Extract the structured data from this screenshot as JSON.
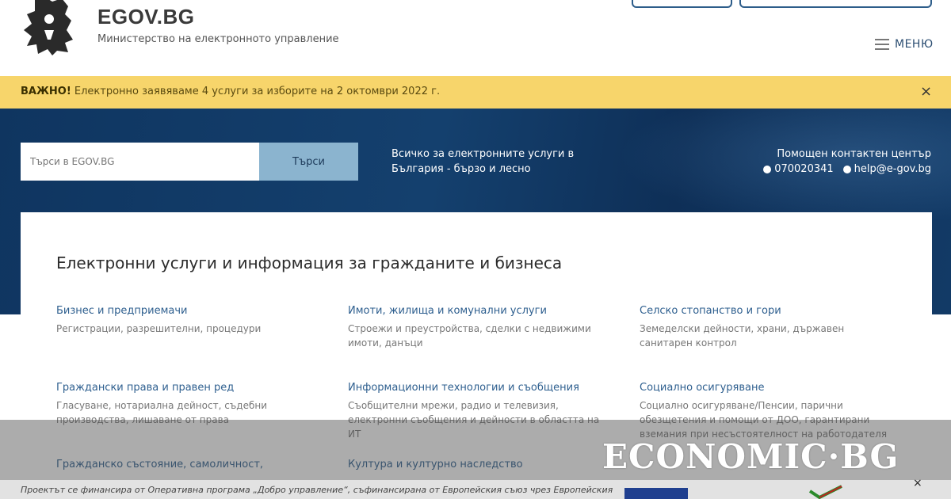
{
  "header": {
    "site_title": "EGOV.BG",
    "site_subtitle": "Министерство на електронното управление",
    "menu_label": "МЕНЮ"
  },
  "notice": {
    "strong": "ВАЖНО!",
    "text": " Електронно заявяваме 4 услуги за изборите на 2 октомври 2022 г.",
    "close": "×"
  },
  "hero": {
    "search_placeholder": "Търси в EGOV.BG",
    "search_button": "Търси",
    "tagline_line1": "Всичко за електронните услуги в",
    "tagline_line2": "България - бързо и лесно",
    "contact_title": "Помощен контактен център",
    "phone": "070020341",
    "email": "help@e-gov.bg"
  },
  "services": {
    "title": "Електронни услуги и информация за гражданите и бизнеса",
    "items": [
      {
        "title": "Бизнес и предприемачи",
        "desc": "Регистрации, разрешителни, процедури"
      },
      {
        "title": "Имоти, жилища и комунални услуги",
        "desc": "Строежи и преустройства, сделки с недвижими имоти, данъци"
      },
      {
        "title": "Селско стопанство и гори",
        "desc": "Земеделски дейности, храни, държавен санитарен контрол"
      },
      {
        "title": "Граждански права и правен ред",
        "desc": "Гласуване, нотариална дейност, съдебни производства, лишаване от права"
      },
      {
        "title": "Информационни технологии и съобщения",
        "desc": "Съобщителни мрежи, радио и телевизия, електронни съобщения и дейности в областта на ИТ"
      },
      {
        "title": "Социално осигуряване",
        "desc": "Социално осигуряване/Пенсии, парични обезщетения и помощи от ДОО, гарантирани вземания при несъстоятелност на работодателя"
      },
      {
        "title": "Гражданско състояние, самоличност,",
        "desc": ""
      },
      {
        "title": "Култура и културно наследство",
        "desc": ""
      }
    ]
  },
  "footer": {
    "text": "Проектът се финансира от Оперативна програма „Добро управление“, съфинансирана от Европейския съюз чрез Европейския",
    "close": "×"
  },
  "watermark": "ECONOMIC·BG",
  "colors": {
    "notice_bg": "#f7d56b",
    "hero_bg": "#14406e",
    "link": "#2e5f8f",
    "search_button": "#8bb4cf"
  }
}
